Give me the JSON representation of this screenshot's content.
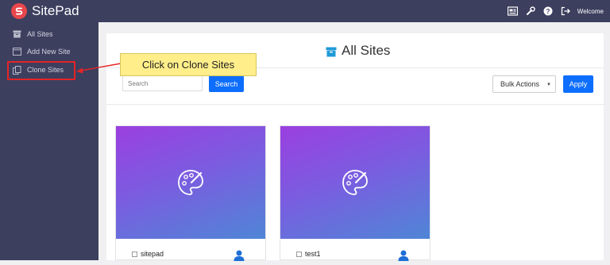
{
  "app": {
    "name": "SitePad"
  },
  "header": {
    "welcome": "Welcome"
  },
  "sidebar": {
    "items": [
      {
        "label": "All Sites",
        "icon": "archive-icon"
      },
      {
        "label": "Add New Site",
        "icon": "add-site-icon"
      },
      {
        "label": "Clone Sites",
        "icon": "clone-icon"
      }
    ]
  },
  "callout": {
    "text": "Click on Clone Sites"
  },
  "main": {
    "title": "All Sites",
    "search": {
      "placeholder": "Search",
      "button": "Search"
    },
    "bulk_actions": {
      "selected": "Bulk Actions"
    },
    "apply": "Apply",
    "sites": [
      {
        "name": "sitepad"
      },
      {
        "name": "test1"
      }
    ]
  },
  "colors": {
    "topbar": "#3c3f5e",
    "accent": "#0d6efd",
    "highlight": "#e52426",
    "callout": "#ffee8a",
    "banner_start": "#9b3fe0",
    "banner_end": "#4f86d6"
  }
}
